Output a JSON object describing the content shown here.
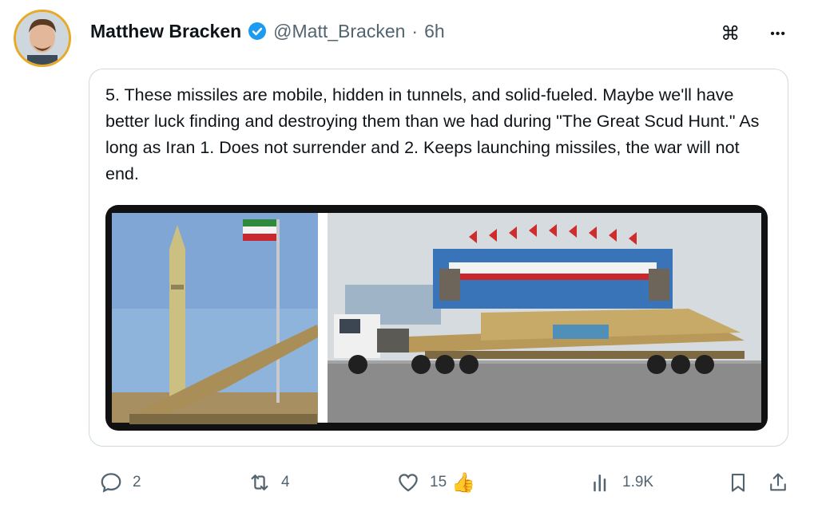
{
  "post": {
    "author_name": "Matthew Bracken",
    "handle": "@Matt_Bracken",
    "separator": "·",
    "time": "6h"
  },
  "top_icons": {
    "grok": "⌘",
    "more": "•••"
  },
  "quote": {
    "text": "5. These missiles are mobile, hidden in tunnels, and solid-fueled. Maybe we'll have better luck finding and destroying them than we had during \"The Great Scud Hunt.\" As long as Iran 1. Does not surrender and 2. Keeps launching missiles, the war will not end."
  },
  "actions": {
    "replies": "2",
    "reposts": "4",
    "likes": "15",
    "reaction_emoji": "👍",
    "views": "1.9K"
  },
  "colors": {
    "verified": "#1d9bf0",
    "avatar_ring": "#e8a928",
    "muted_text": "#536471"
  }
}
